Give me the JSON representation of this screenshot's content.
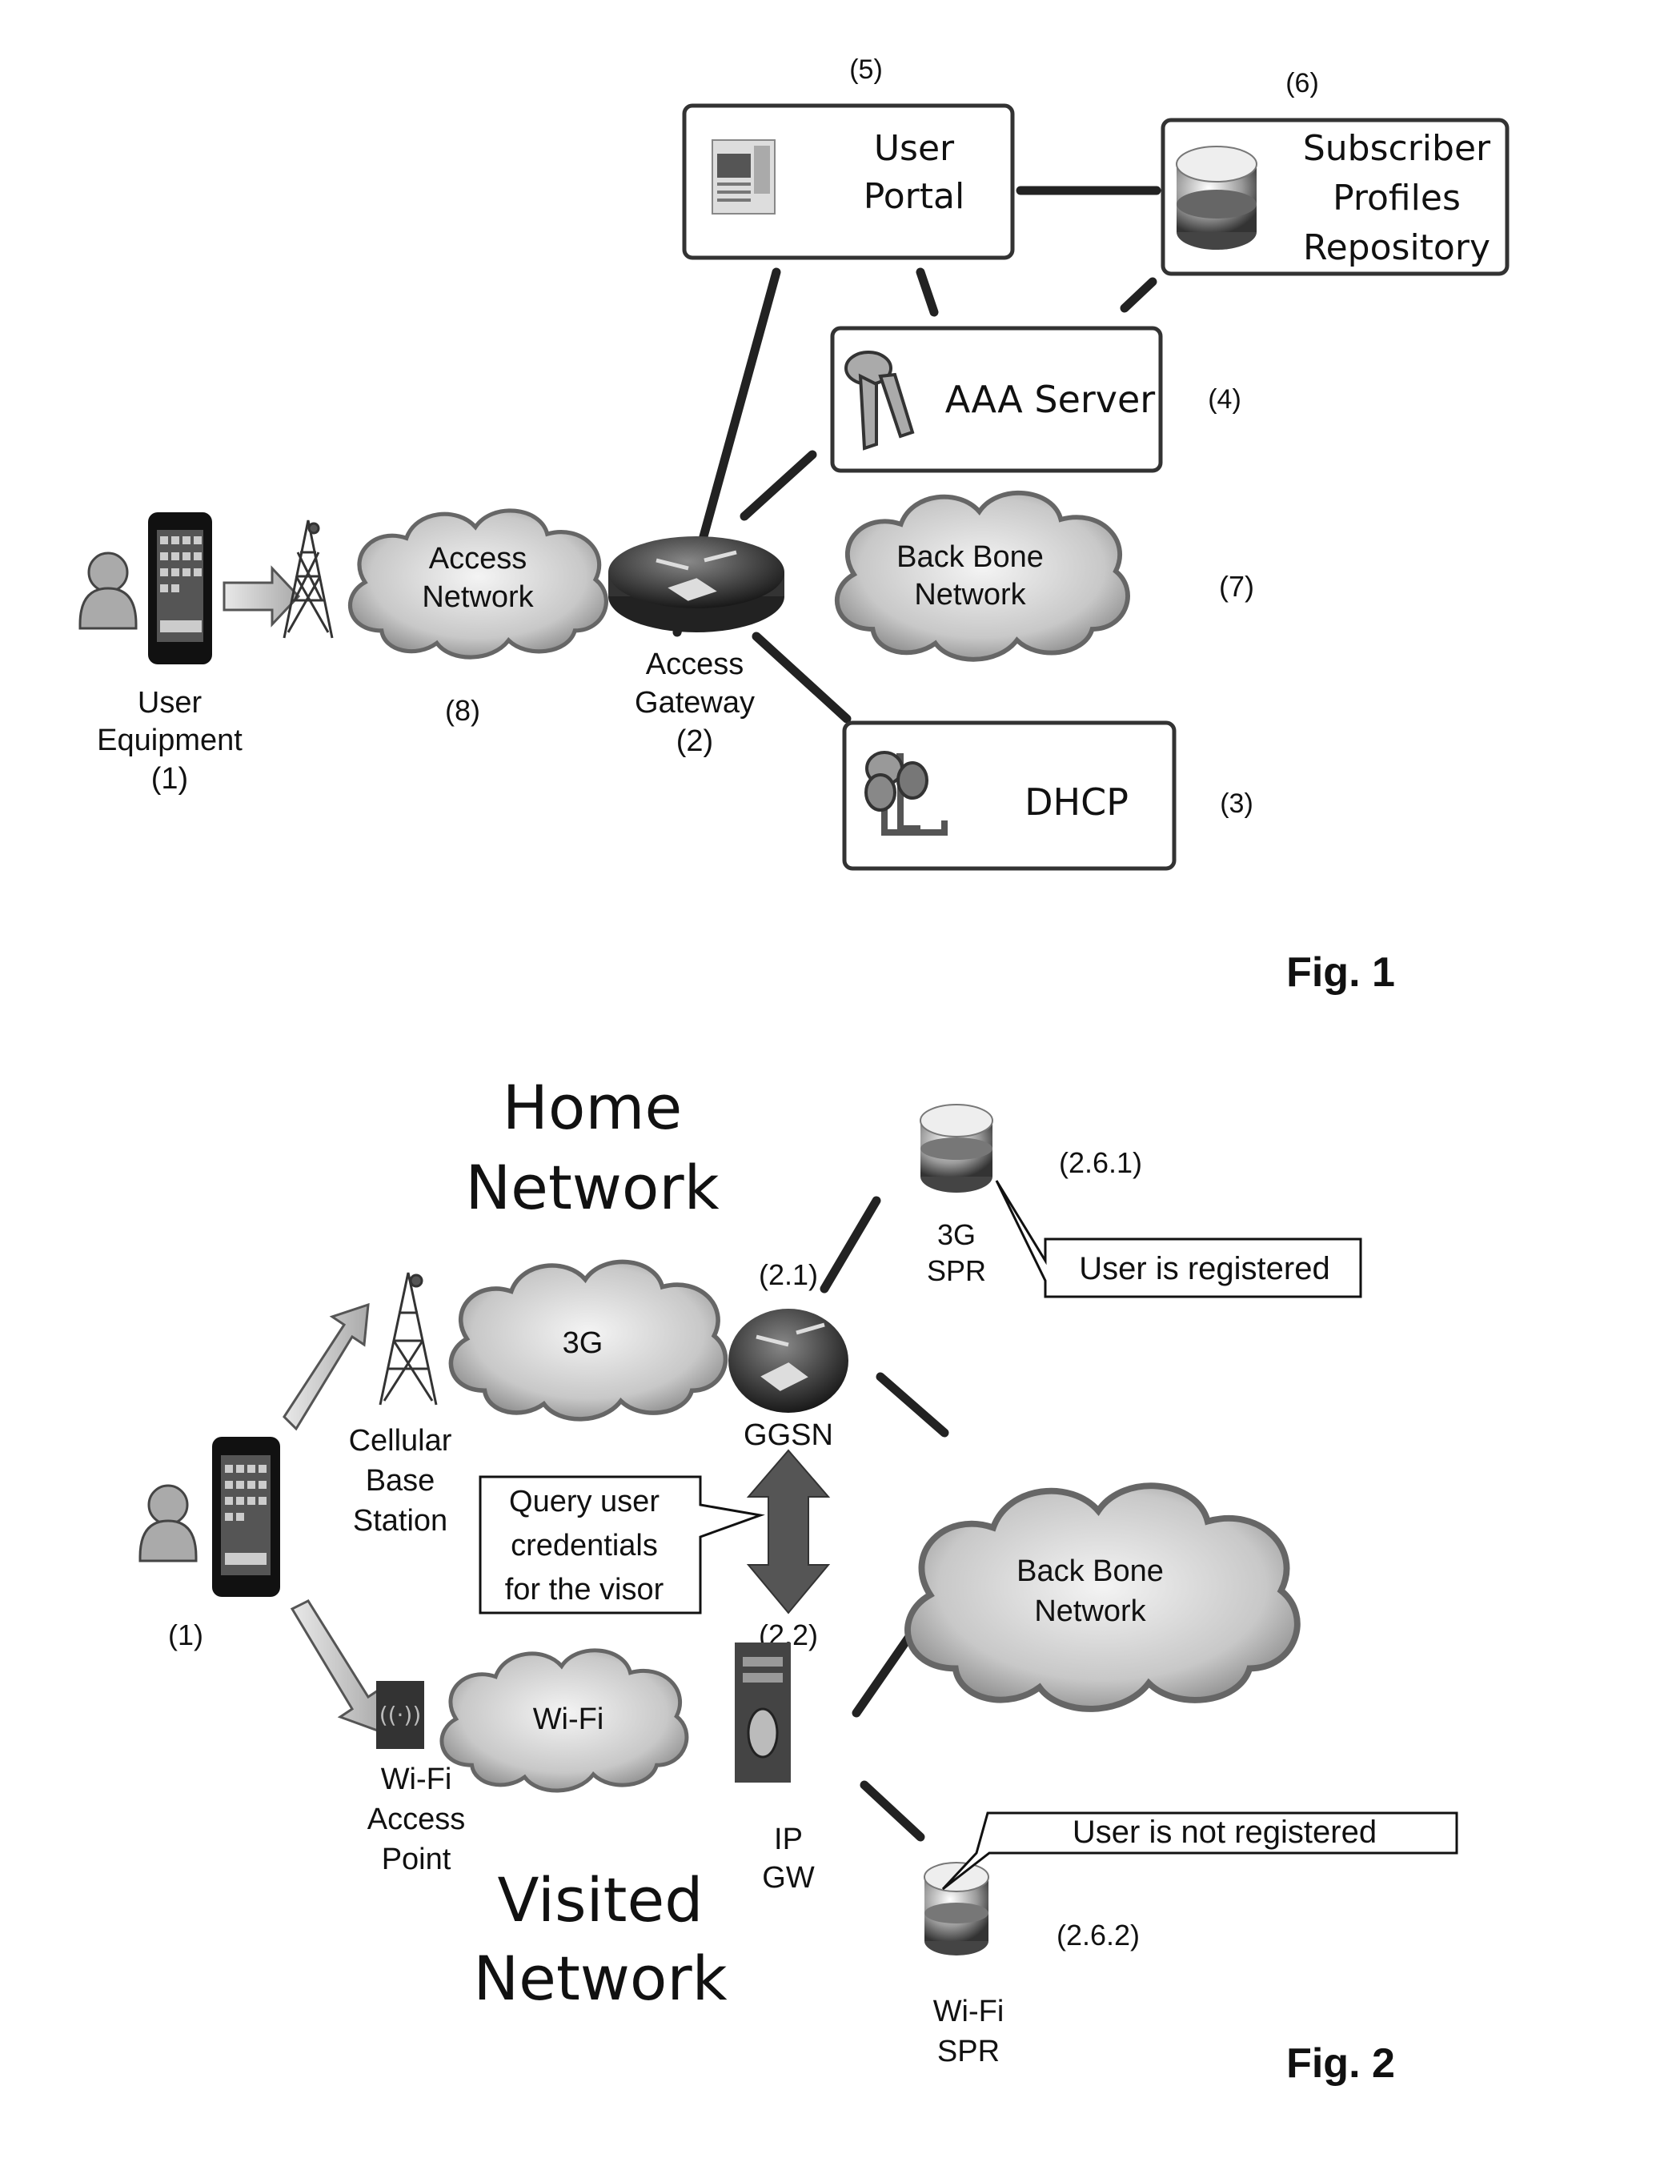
{
  "fig1": {
    "caption": "Fig. 1",
    "user_equipment": {
      "label_line1": "User",
      "label_line2": "Equipment",
      "ref": "(1)"
    },
    "access_network": {
      "line1": "Access",
      "line2": "Network",
      "ref": "(8)"
    },
    "access_gateway": {
      "line1": "Access",
      "line2": "Gateway",
      "ref": "(2)"
    },
    "dhcp": {
      "label": "DHCP",
      "ref": "(3)"
    },
    "aaa_server": {
      "label": "AAA Server",
      "ref": "(4)"
    },
    "user_portal": {
      "line1": "User",
      "line2": "Portal",
      "ref": "(5)"
    },
    "spr": {
      "line1": "Subscriber",
      "line2": "Profiles",
      "line3": "Repository",
      "ref": "(6)"
    },
    "backbone": {
      "line1": "Back Bone",
      "line2": "Network",
      "ref": "(7)"
    }
  },
  "fig2": {
    "caption": "Fig. 2",
    "home_network": {
      "line1": "Home",
      "line2": "Network"
    },
    "visited_network": {
      "line1": "Visited",
      "line2": "Network"
    },
    "user_ref": "(1)",
    "cellular_bs": {
      "line1": "Cellular",
      "line2": "Base",
      "line3": "Station"
    },
    "cloud_3g": "3G",
    "ggsn": {
      "label": "GGSN",
      "ref": "(2.1)"
    },
    "spr_3g": {
      "line1": "3G",
      "line2": "SPR",
      "ref": "(2.6.1)",
      "callout": "User is registered"
    },
    "query_callout": {
      "line1": "Query user",
      "line2": "credentials",
      "line3": "for the visor"
    },
    "wifi_ap": {
      "line1": "Wi-Fi",
      "line2": "Access",
      "line3": "Point"
    },
    "cloud_wifi": "Wi-Fi",
    "ip_gw": {
      "line1": "IP",
      "line2": "GW",
      "ref": "(2.2)"
    },
    "backbone": {
      "line1": "Back Bone",
      "line2": "Network"
    },
    "spr_wifi": {
      "line1": "Wi-Fi",
      "line2": "SPR",
      "ref": "(2.6.2)",
      "callout": "User is not registered"
    }
  }
}
